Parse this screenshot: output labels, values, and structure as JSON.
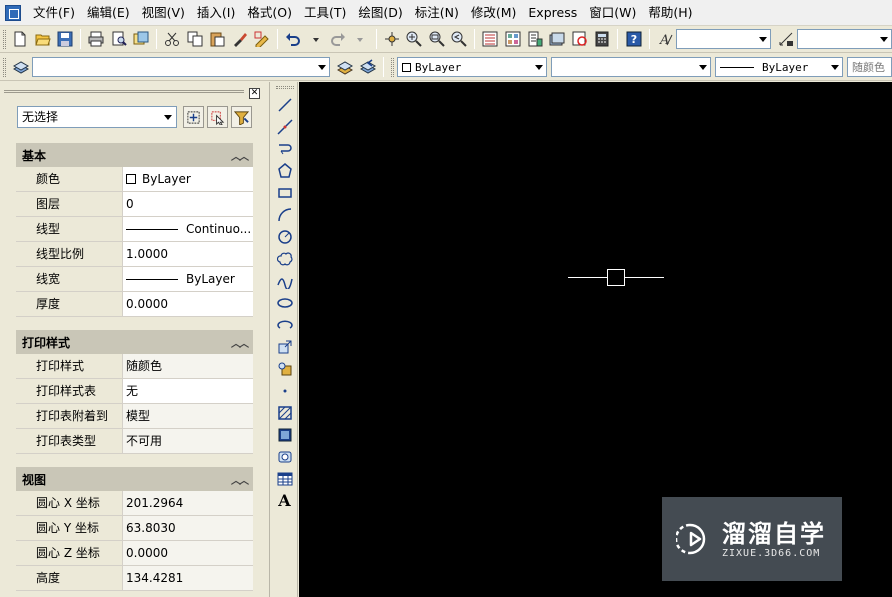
{
  "menu": {
    "items": [
      "文件(F)",
      "编辑(E)",
      "视图(V)",
      "插入(I)",
      "格式(O)",
      "工具(T)",
      "绘图(D)",
      "标注(N)",
      "修改(M)",
      "Express",
      "窗口(W)",
      "帮助(H)"
    ]
  },
  "toolbar": {
    "color_combo": "ByLayer",
    "linetype_combo": "ByLayer",
    "plotstyle_combo": "随颜色"
  },
  "properties": {
    "selection": "无选择",
    "sections": [
      {
        "title": "基本",
        "rows": [
          {
            "label": "颜色",
            "value": "ByLayer"
          },
          {
            "label": "图层",
            "value": "0"
          },
          {
            "label": "线型",
            "value": "Continuo..."
          },
          {
            "label": "线型比例",
            "value": "1.0000"
          },
          {
            "label": "线宽",
            "value": "ByLayer"
          },
          {
            "label": "厚度",
            "value": "0.0000"
          }
        ]
      },
      {
        "title": "打印样式",
        "rows": [
          {
            "label": "打印样式",
            "value": "随颜色"
          },
          {
            "label": "打印样式表",
            "value": "无"
          },
          {
            "label": "打印表附着到",
            "value": "模型"
          },
          {
            "label": "打印表类型",
            "value": "不可用"
          }
        ]
      },
      {
        "title": "视图",
        "rows": [
          {
            "label": "圆心 X 坐标",
            "value": "201.2964"
          },
          {
            "label": "圆心 Y 坐标",
            "value": "63.8030"
          },
          {
            "label": "圆心 Z 坐标",
            "value": "0.0000"
          },
          {
            "label": "高度",
            "value": "134.4281"
          }
        ]
      }
    ]
  },
  "draw_toolbar": {
    "text_tool": "A"
  },
  "watermark": {
    "brand": "溜溜自学",
    "url": "ZIXUE.3D66.COM"
  },
  "colors": {
    "canvas": "#000000",
    "panel": "#ece9d8",
    "section_header": "#c9c6b7"
  }
}
